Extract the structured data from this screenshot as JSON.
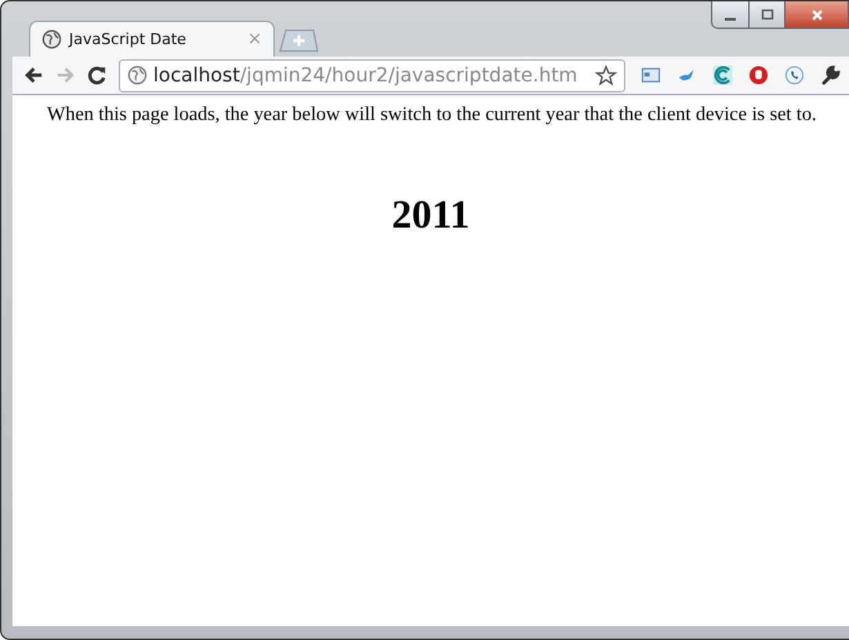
{
  "tab": {
    "title": "JavaScript Date",
    "close": "×",
    "selected": true
  },
  "address": {
    "host": "localhost",
    "path": "/jqmin24/hour2/javascriptdate.htm"
  },
  "page": {
    "intro": "When this page loads, the year below will switch to the current year that the client device is set to.",
    "year": "2011"
  }
}
